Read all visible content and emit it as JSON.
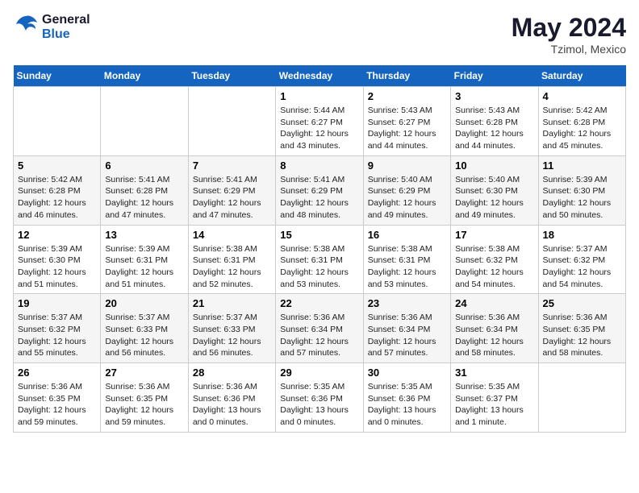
{
  "header": {
    "logo_line1": "General",
    "logo_line2": "Blue",
    "month_year": "May 2024",
    "location": "Tzimol, Mexico"
  },
  "days_of_week": [
    "Sunday",
    "Monday",
    "Tuesday",
    "Wednesday",
    "Thursday",
    "Friday",
    "Saturday"
  ],
  "weeks": [
    [
      {
        "day": "",
        "info": ""
      },
      {
        "day": "",
        "info": ""
      },
      {
        "day": "",
        "info": ""
      },
      {
        "day": "1",
        "info": "Sunrise: 5:44 AM\nSunset: 6:27 PM\nDaylight: 12 hours\nand 43 minutes."
      },
      {
        "day": "2",
        "info": "Sunrise: 5:43 AM\nSunset: 6:27 PM\nDaylight: 12 hours\nand 44 minutes."
      },
      {
        "day": "3",
        "info": "Sunrise: 5:43 AM\nSunset: 6:28 PM\nDaylight: 12 hours\nand 44 minutes."
      },
      {
        "day": "4",
        "info": "Sunrise: 5:42 AM\nSunset: 6:28 PM\nDaylight: 12 hours\nand 45 minutes."
      }
    ],
    [
      {
        "day": "5",
        "info": "Sunrise: 5:42 AM\nSunset: 6:28 PM\nDaylight: 12 hours\nand 46 minutes."
      },
      {
        "day": "6",
        "info": "Sunrise: 5:41 AM\nSunset: 6:28 PM\nDaylight: 12 hours\nand 47 minutes."
      },
      {
        "day": "7",
        "info": "Sunrise: 5:41 AM\nSunset: 6:29 PM\nDaylight: 12 hours\nand 47 minutes."
      },
      {
        "day": "8",
        "info": "Sunrise: 5:41 AM\nSunset: 6:29 PM\nDaylight: 12 hours\nand 48 minutes."
      },
      {
        "day": "9",
        "info": "Sunrise: 5:40 AM\nSunset: 6:29 PM\nDaylight: 12 hours\nand 49 minutes."
      },
      {
        "day": "10",
        "info": "Sunrise: 5:40 AM\nSunset: 6:30 PM\nDaylight: 12 hours\nand 49 minutes."
      },
      {
        "day": "11",
        "info": "Sunrise: 5:39 AM\nSunset: 6:30 PM\nDaylight: 12 hours\nand 50 minutes."
      }
    ],
    [
      {
        "day": "12",
        "info": "Sunrise: 5:39 AM\nSunset: 6:30 PM\nDaylight: 12 hours\nand 51 minutes."
      },
      {
        "day": "13",
        "info": "Sunrise: 5:39 AM\nSunset: 6:31 PM\nDaylight: 12 hours\nand 51 minutes."
      },
      {
        "day": "14",
        "info": "Sunrise: 5:38 AM\nSunset: 6:31 PM\nDaylight: 12 hours\nand 52 minutes."
      },
      {
        "day": "15",
        "info": "Sunrise: 5:38 AM\nSunset: 6:31 PM\nDaylight: 12 hours\nand 53 minutes."
      },
      {
        "day": "16",
        "info": "Sunrise: 5:38 AM\nSunset: 6:31 PM\nDaylight: 12 hours\nand 53 minutes."
      },
      {
        "day": "17",
        "info": "Sunrise: 5:38 AM\nSunset: 6:32 PM\nDaylight: 12 hours\nand 54 minutes."
      },
      {
        "day": "18",
        "info": "Sunrise: 5:37 AM\nSunset: 6:32 PM\nDaylight: 12 hours\nand 54 minutes."
      }
    ],
    [
      {
        "day": "19",
        "info": "Sunrise: 5:37 AM\nSunset: 6:32 PM\nDaylight: 12 hours\nand 55 minutes."
      },
      {
        "day": "20",
        "info": "Sunrise: 5:37 AM\nSunset: 6:33 PM\nDaylight: 12 hours\nand 56 minutes."
      },
      {
        "day": "21",
        "info": "Sunrise: 5:37 AM\nSunset: 6:33 PM\nDaylight: 12 hours\nand 56 minutes."
      },
      {
        "day": "22",
        "info": "Sunrise: 5:36 AM\nSunset: 6:34 PM\nDaylight: 12 hours\nand 57 minutes."
      },
      {
        "day": "23",
        "info": "Sunrise: 5:36 AM\nSunset: 6:34 PM\nDaylight: 12 hours\nand 57 minutes."
      },
      {
        "day": "24",
        "info": "Sunrise: 5:36 AM\nSunset: 6:34 PM\nDaylight: 12 hours\nand 58 minutes."
      },
      {
        "day": "25",
        "info": "Sunrise: 5:36 AM\nSunset: 6:35 PM\nDaylight: 12 hours\nand 58 minutes."
      }
    ],
    [
      {
        "day": "26",
        "info": "Sunrise: 5:36 AM\nSunset: 6:35 PM\nDaylight: 12 hours\nand 59 minutes."
      },
      {
        "day": "27",
        "info": "Sunrise: 5:36 AM\nSunset: 6:35 PM\nDaylight: 12 hours\nand 59 minutes."
      },
      {
        "day": "28",
        "info": "Sunrise: 5:36 AM\nSunset: 6:36 PM\nDaylight: 13 hours\nand 0 minutes."
      },
      {
        "day": "29",
        "info": "Sunrise: 5:35 AM\nSunset: 6:36 PM\nDaylight: 13 hours\nand 0 minutes."
      },
      {
        "day": "30",
        "info": "Sunrise: 5:35 AM\nSunset: 6:36 PM\nDaylight: 13 hours\nand 0 minutes."
      },
      {
        "day": "31",
        "info": "Sunrise: 5:35 AM\nSunset: 6:37 PM\nDaylight: 13 hours\nand 1 minute."
      },
      {
        "day": "",
        "info": ""
      }
    ]
  ]
}
